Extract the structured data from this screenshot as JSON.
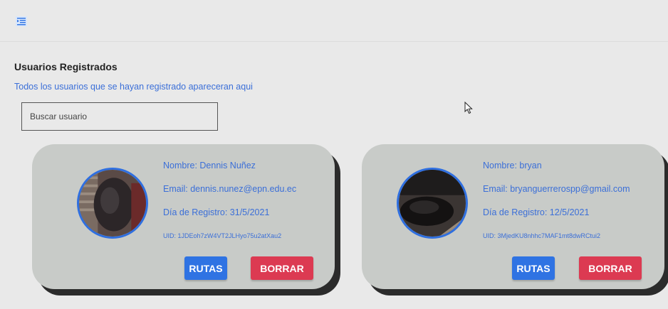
{
  "header": {
    "menu_icon": "menu-toggle-icon"
  },
  "main": {
    "title": "Usuarios Registrados",
    "subtitle": "Todos los usuarios que se hayan registrado apareceran aqui",
    "search": {
      "placeholder": "Buscar usuario",
      "value": ""
    }
  },
  "users": [
    {
      "nombre": "Nombre: Dennis Nuñez",
      "email": "Email: dennis.nunez@epn.edu.ec",
      "registro": "Día de Registro: 31/5/2021",
      "uid": "UID: 1JDEoh7zW4VT2JLHyo75u2atXau2",
      "rutas_label": "RUTAS",
      "borrar_label": "BORRAR"
    },
    {
      "nombre": "Nombre: bryan",
      "email": "Email: bryanguerrerospp@gmail.com",
      "registro": "Día de Registro: 12/5/2021",
      "uid": "UID: 3MjedKU8nhhc7MAF1mt8dwRCtui2",
      "rutas_label": "RUTAS",
      "borrar_label": "BORRAR"
    }
  ],
  "colors": {
    "background": "#e9e9e9",
    "card": "#c8cbc8",
    "link_text": "#3b6fd8",
    "primary_button": "#2f73e3",
    "danger_button": "#dc3a52",
    "avatar_border": "#2f6fe0"
  }
}
